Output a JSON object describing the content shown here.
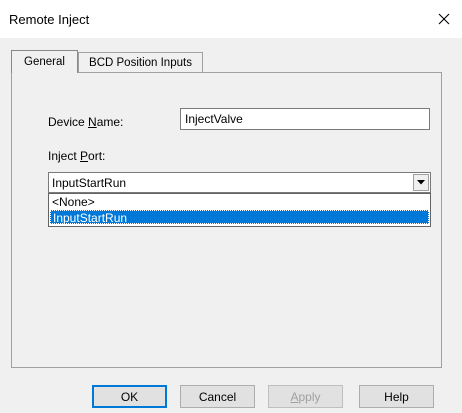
{
  "window": {
    "title": "Remote Inject",
    "close_glyph": "✕"
  },
  "tabs": [
    {
      "label": "General",
      "active": true
    },
    {
      "label": "BCD Position Inputs",
      "active": false
    }
  ],
  "form": {
    "device_name_label_prefix": "Device ",
    "device_name_label_accel": "N",
    "device_name_label_suffix": "ame:",
    "device_name_value": "InjectValve",
    "inject_port_label_prefix": "Inject ",
    "inject_port_label_accel": "P",
    "inject_port_label_suffix": "ort:",
    "inject_port_value": "InputStartRun",
    "inject_port_options": [
      "<None>",
      "InputStartRun"
    ],
    "inject_port_selected_index": 1
  },
  "buttons": {
    "ok": "OK",
    "cancel": "Cancel",
    "apply_accel": "A",
    "apply_rest": "pply",
    "help": "Help"
  },
  "colors": {
    "selection": "#0078d7",
    "dialog_bg": "#f0f0f0"
  }
}
